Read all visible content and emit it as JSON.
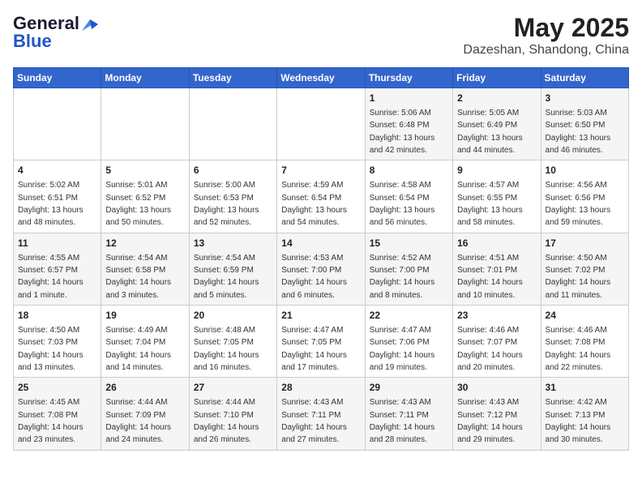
{
  "logo": {
    "general": "General",
    "blue": "Blue"
  },
  "title": "May 2025",
  "subtitle": "Dazeshan, Shandong, China",
  "days_of_week": [
    "Sunday",
    "Monday",
    "Tuesday",
    "Wednesday",
    "Thursday",
    "Friday",
    "Saturday"
  ],
  "weeks": [
    [
      {
        "day": "",
        "info": ""
      },
      {
        "day": "",
        "info": ""
      },
      {
        "day": "",
        "info": ""
      },
      {
        "day": "",
        "info": ""
      },
      {
        "day": "1",
        "info": "Sunrise: 5:06 AM\nSunset: 6:48 PM\nDaylight: 13 hours and 42 minutes."
      },
      {
        "day": "2",
        "info": "Sunrise: 5:05 AM\nSunset: 6:49 PM\nDaylight: 13 hours and 44 minutes."
      },
      {
        "day": "3",
        "info": "Sunrise: 5:03 AM\nSunset: 6:50 PM\nDaylight: 13 hours and 46 minutes."
      }
    ],
    [
      {
        "day": "4",
        "info": "Sunrise: 5:02 AM\nSunset: 6:51 PM\nDaylight: 13 hours and 48 minutes."
      },
      {
        "day": "5",
        "info": "Sunrise: 5:01 AM\nSunset: 6:52 PM\nDaylight: 13 hours and 50 minutes."
      },
      {
        "day": "6",
        "info": "Sunrise: 5:00 AM\nSunset: 6:53 PM\nDaylight: 13 hours and 52 minutes."
      },
      {
        "day": "7",
        "info": "Sunrise: 4:59 AM\nSunset: 6:54 PM\nDaylight: 13 hours and 54 minutes."
      },
      {
        "day": "8",
        "info": "Sunrise: 4:58 AM\nSunset: 6:54 PM\nDaylight: 13 hours and 56 minutes."
      },
      {
        "day": "9",
        "info": "Sunrise: 4:57 AM\nSunset: 6:55 PM\nDaylight: 13 hours and 58 minutes."
      },
      {
        "day": "10",
        "info": "Sunrise: 4:56 AM\nSunset: 6:56 PM\nDaylight: 13 hours and 59 minutes."
      }
    ],
    [
      {
        "day": "11",
        "info": "Sunrise: 4:55 AM\nSunset: 6:57 PM\nDaylight: 14 hours and 1 minute."
      },
      {
        "day": "12",
        "info": "Sunrise: 4:54 AM\nSunset: 6:58 PM\nDaylight: 14 hours and 3 minutes."
      },
      {
        "day": "13",
        "info": "Sunrise: 4:54 AM\nSunset: 6:59 PM\nDaylight: 14 hours and 5 minutes."
      },
      {
        "day": "14",
        "info": "Sunrise: 4:53 AM\nSunset: 7:00 PM\nDaylight: 14 hours and 6 minutes."
      },
      {
        "day": "15",
        "info": "Sunrise: 4:52 AM\nSunset: 7:00 PM\nDaylight: 14 hours and 8 minutes."
      },
      {
        "day": "16",
        "info": "Sunrise: 4:51 AM\nSunset: 7:01 PM\nDaylight: 14 hours and 10 minutes."
      },
      {
        "day": "17",
        "info": "Sunrise: 4:50 AM\nSunset: 7:02 PM\nDaylight: 14 hours and 11 minutes."
      }
    ],
    [
      {
        "day": "18",
        "info": "Sunrise: 4:50 AM\nSunset: 7:03 PM\nDaylight: 14 hours and 13 minutes."
      },
      {
        "day": "19",
        "info": "Sunrise: 4:49 AM\nSunset: 7:04 PM\nDaylight: 14 hours and 14 minutes."
      },
      {
        "day": "20",
        "info": "Sunrise: 4:48 AM\nSunset: 7:05 PM\nDaylight: 14 hours and 16 minutes."
      },
      {
        "day": "21",
        "info": "Sunrise: 4:47 AM\nSunset: 7:05 PM\nDaylight: 14 hours and 17 minutes."
      },
      {
        "day": "22",
        "info": "Sunrise: 4:47 AM\nSunset: 7:06 PM\nDaylight: 14 hours and 19 minutes."
      },
      {
        "day": "23",
        "info": "Sunrise: 4:46 AM\nSunset: 7:07 PM\nDaylight: 14 hours and 20 minutes."
      },
      {
        "day": "24",
        "info": "Sunrise: 4:46 AM\nSunset: 7:08 PM\nDaylight: 14 hours and 22 minutes."
      }
    ],
    [
      {
        "day": "25",
        "info": "Sunrise: 4:45 AM\nSunset: 7:08 PM\nDaylight: 14 hours and 23 minutes."
      },
      {
        "day": "26",
        "info": "Sunrise: 4:44 AM\nSunset: 7:09 PM\nDaylight: 14 hours and 24 minutes."
      },
      {
        "day": "27",
        "info": "Sunrise: 4:44 AM\nSunset: 7:10 PM\nDaylight: 14 hours and 26 minutes."
      },
      {
        "day": "28",
        "info": "Sunrise: 4:43 AM\nSunset: 7:11 PM\nDaylight: 14 hours and 27 minutes."
      },
      {
        "day": "29",
        "info": "Sunrise: 4:43 AM\nSunset: 7:11 PM\nDaylight: 14 hours and 28 minutes."
      },
      {
        "day": "30",
        "info": "Sunrise: 4:43 AM\nSunset: 7:12 PM\nDaylight: 14 hours and 29 minutes."
      },
      {
        "day": "31",
        "info": "Sunrise: 4:42 AM\nSunset: 7:13 PM\nDaylight: 14 hours and 30 minutes."
      }
    ]
  ]
}
